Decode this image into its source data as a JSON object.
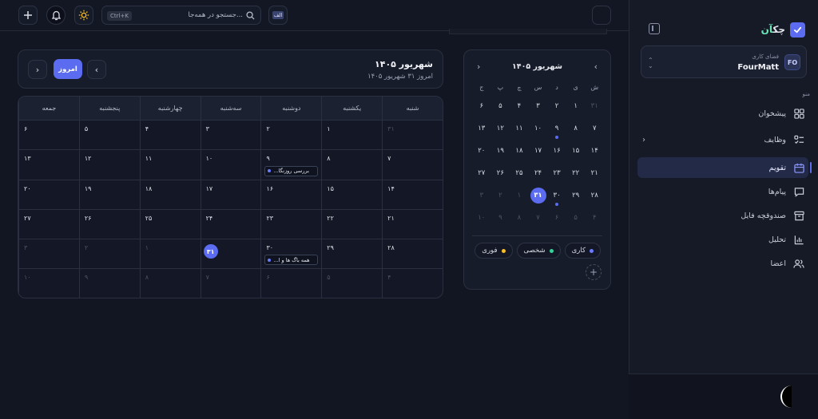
{
  "sidebar": {
    "brand_prefix": "چک",
    "brand_suffix": "آن",
    "workspace": {
      "label": "فضای کاری",
      "name": "FourMatt",
      "initials": "FO"
    },
    "menu_title": "منو",
    "items": [
      {
        "label": "پیشخوان",
        "icon": "dashboard-icon"
      },
      {
        "label": "وظایف",
        "icon": "tasks-icon"
      },
      {
        "label": "تقویم",
        "icon": "calendar-icon",
        "active": true
      },
      {
        "label": "پیام‌ها",
        "icon": "message-icon"
      },
      {
        "label": "صندوقچه فایل",
        "icon": "archive-icon"
      },
      {
        "label": "تحلیل",
        "icon": "chart-icon"
      },
      {
        "label": "اعضا",
        "icon": "users-icon"
      }
    ]
  },
  "topbar": {
    "search_placeholder": "جستجو در همه‌جا...",
    "shortcut": "Ctrl+K",
    "lang": "الف"
  },
  "mini_calendar": {
    "title": "شهریور ۱۴۰۵",
    "weekdays": [
      "ش",
      "ی",
      "د",
      "س",
      "چ",
      "پ",
      "ج"
    ],
    "days": [
      {
        "n": "۳۱",
        "dim": true
      },
      {
        "n": "۱"
      },
      {
        "n": "۲"
      },
      {
        "n": "۳"
      },
      {
        "n": "۴"
      },
      {
        "n": "۵"
      },
      {
        "n": "۶"
      },
      {
        "n": "۷"
      },
      {
        "n": "۸"
      },
      {
        "n": "۹",
        "dot": true
      },
      {
        "n": "۱۰"
      },
      {
        "n": "۱۱"
      },
      {
        "n": "۱۲"
      },
      {
        "n": "۱۳"
      },
      {
        "n": "۱۴"
      },
      {
        "n": "۱۵"
      },
      {
        "n": "۱۶"
      },
      {
        "n": "۱۷"
      },
      {
        "n": "۱۸"
      },
      {
        "n": "۱۹"
      },
      {
        "n": "۲۰"
      },
      {
        "n": "۲۱"
      },
      {
        "n": "۲۲"
      },
      {
        "n": "۲۳"
      },
      {
        "n": "۲۴"
      },
      {
        "n": "۲۵"
      },
      {
        "n": "۲۶"
      },
      {
        "n": "۲۷"
      },
      {
        "n": "۲۸"
      },
      {
        "n": "۲۹"
      },
      {
        "n": "۳۰",
        "dot": true
      },
      {
        "n": "۳۱",
        "today": true
      },
      {
        "n": "۱",
        "dim": true
      },
      {
        "n": "۲",
        "dim": true
      },
      {
        "n": "۳",
        "dim": true
      },
      {
        "n": "۴",
        "dim": true
      },
      {
        "n": "۵",
        "dim": true
      },
      {
        "n": "۶",
        "dim": true
      },
      {
        "n": "۷",
        "dim": true
      },
      {
        "n": "۸",
        "dim": true
      },
      {
        "n": "۹",
        "dim": true
      },
      {
        "n": "۱۰",
        "dim": true
      }
    ],
    "categories": [
      {
        "label": "کاری",
        "color": "#6b7bff"
      },
      {
        "label": "شخصی",
        "color": "#34d399"
      },
      {
        "label": "فوری",
        "color": "#fbbf24"
      }
    ]
  },
  "calendar": {
    "title": "شهریور ۱۴۰۵",
    "subtitle": "امروز ۳۱ شهریور ۱۴۰۵",
    "today_label": "امروز",
    "weekdays": [
      "شنبه",
      "یکشنبه",
      "دوشنبه",
      "سه‌شنبه",
      "چهارشنبه",
      "پنجشنبه",
      "جمعه"
    ],
    "days": [
      {
        "n": "۳۱",
        "dim": true
      },
      {
        "n": "۱"
      },
      {
        "n": "۲"
      },
      {
        "n": "۳"
      },
      {
        "n": "۴"
      },
      {
        "n": "۵"
      },
      {
        "n": "۶"
      },
      {
        "n": "۷"
      },
      {
        "n": "۸"
      },
      {
        "n": "۹",
        "event": "بررسی روزنگا..."
      },
      {
        "n": "۱۰"
      },
      {
        "n": "۱۱"
      },
      {
        "n": "۱۲"
      },
      {
        "n": "۱۳"
      },
      {
        "n": "۱۴"
      },
      {
        "n": "۱۵"
      },
      {
        "n": "۱۶"
      },
      {
        "n": "۱۷"
      },
      {
        "n": "۱۸"
      },
      {
        "n": "۱۹"
      },
      {
        "n": "۲۰"
      },
      {
        "n": "۲۱"
      },
      {
        "n": "۲۲"
      },
      {
        "n": "۲۳"
      },
      {
        "n": "۲۴"
      },
      {
        "n": "۲۵"
      },
      {
        "n": "۲۶"
      },
      {
        "n": "۲۷"
      },
      {
        "n": "۲۸"
      },
      {
        "n": "۲۹"
      },
      {
        "n": "۳۰",
        "event": "همه باگ ها و ا..."
      },
      {
        "n": "۳۱",
        "today": true
      },
      {
        "n": "۱",
        "dim": true
      },
      {
        "n": "۲",
        "dim": true
      },
      {
        "n": "۳",
        "dim": true
      },
      {
        "n": "۴",
        "dim": true
      },
      {
        "n": "۵",
        "dim": true
      },
      {
        "n": "۶",
        "dim": true
      },
      {
        "n": "۷",
        "dim": true
      },
      {
        "n": "۸",
        "dim": true
      },
      {
        "n": "۹",
        "dim": true
      },
      {
        "n": "۱۰",
        "dim": true
      }
    ]
  }
}
